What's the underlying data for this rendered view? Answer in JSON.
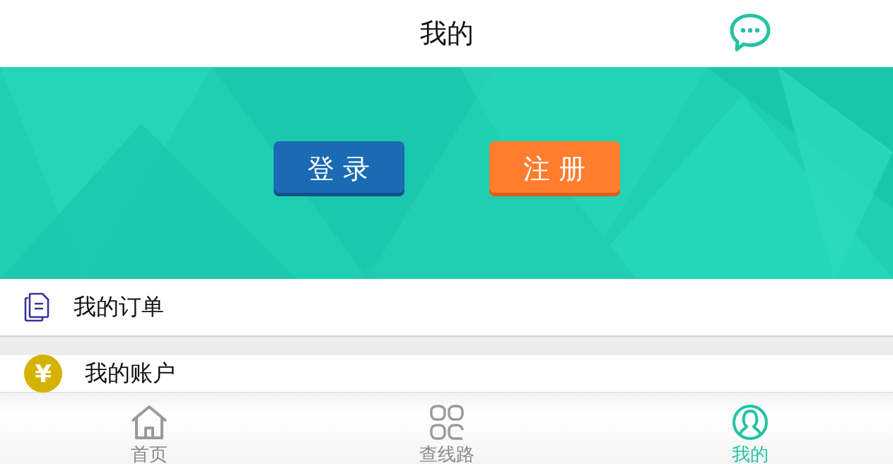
{
  "header": {
    "title": "我的"
  },
  "banner": {
    "buttons": [
      {
        "label": "登 录",
        "kind": "login"
      },
      {
        "label": "注 册",
        "kind": "register"
      }
    ]
  },
  "menu": [
    {
      "label": "我的订单",
      "kind": "orders"
    },
    {
      "label": "我的账户",
      "kind": "account",
      "icon_text": "¥"
    }
  ],
  "tabs": [
    {
      "label": "首页",
      "kind": "home",
      "selected": false
    },
    {
      "label": "查线路",
      "kind": "routes",
      "selected": false
    },
    {
      "label": "我的",
      "kind": "profile",
      "selected": true
    }
  ]
}
